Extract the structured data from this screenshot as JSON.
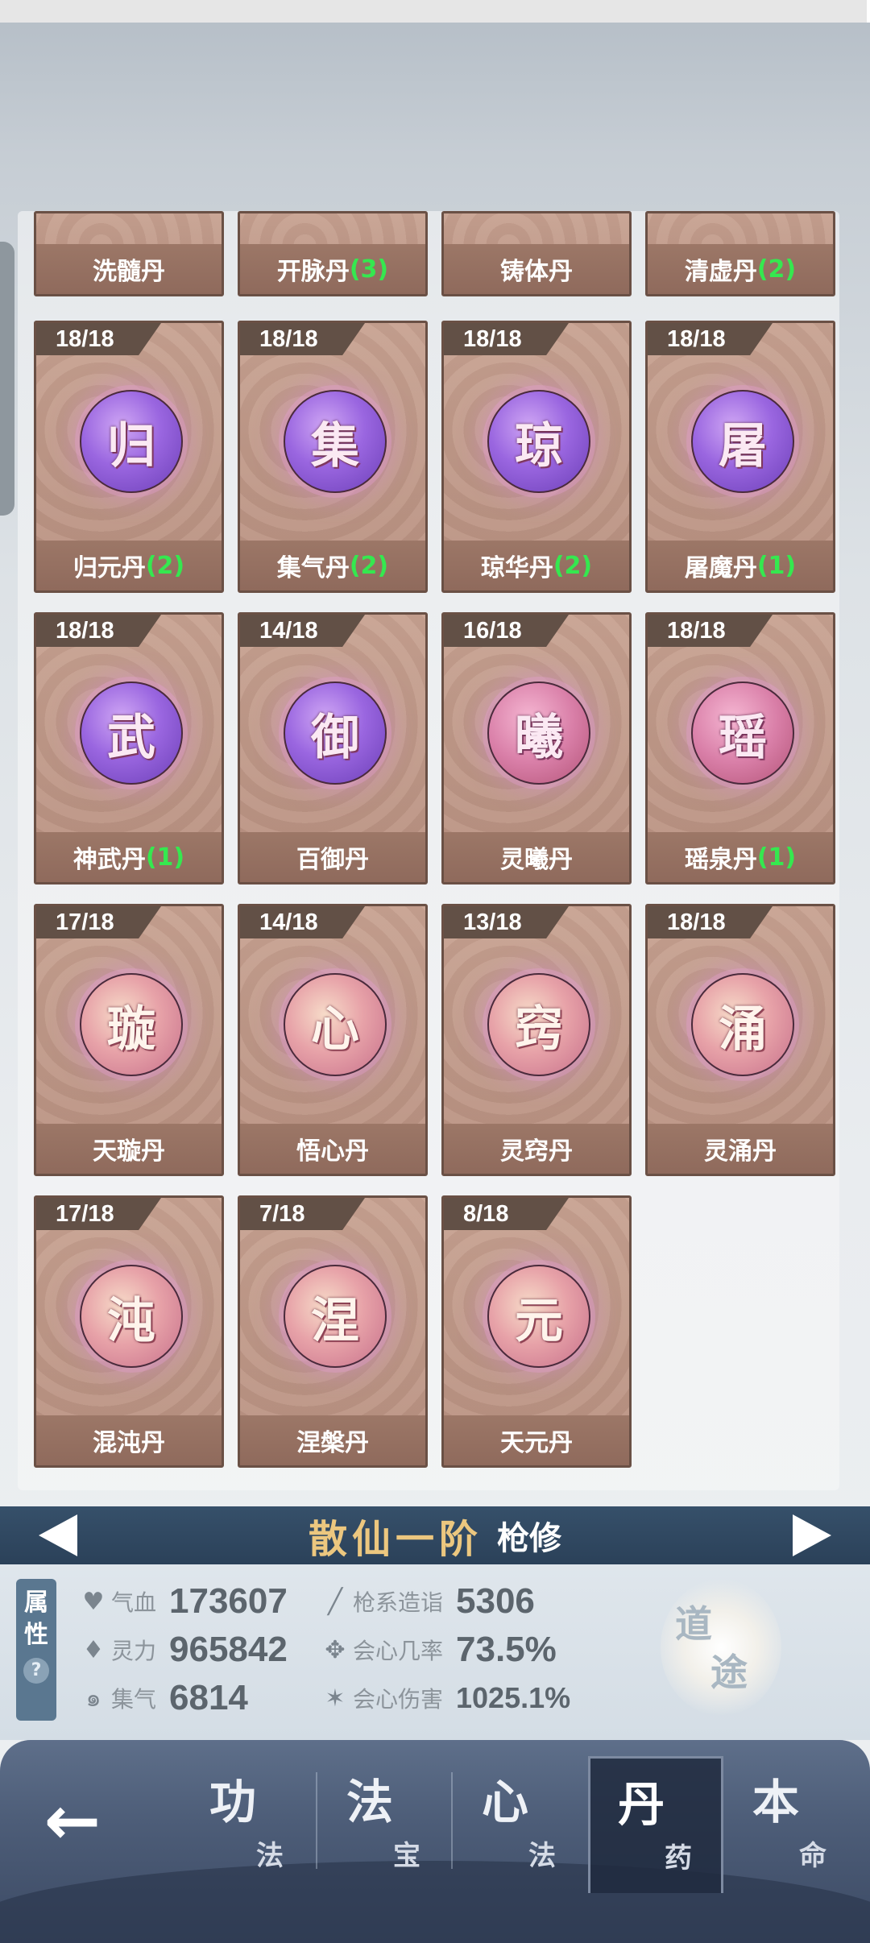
{
  "pills_row_cut": [
    {
      "name": "洗髓丹",
      "extra": ""
    },
    {
      "name": "开脉丹",
      "extra": "(3)"
    },
    {
      "name": "铸体丹",
      "extra": ""
    },
    {
      "name": "清虚丹",
      "extra": "(2)"
    }
  ],
  "pills": [
    {
      "count": "18/18",
      "glyph": "归",
      "name": "归元丹",
      "extra": "(2)",
      "style": "purple"
    },
    {
      "count": "18/18",
      "glyph": "集",
      "name": "集气丹",
      "extra": "(2)",
      "style": "purple"
    },
    {
      "count": "18/18",
      "glyph": "琼",
      "name": "琼华丹",
      "extra": "(2)",
      "style": "purple"
    },
    {
      "count": "18/18",
      "glyph": "屠",
      "name": "屠魔丹",
      "extra": "(1)",
      "style": "purple"
    },
    {
      "count": "18/18",
      "glyph": "武",
      "name": "神武丹",
      "extra": "(1)",
      "style": "purple"
    },
    {
      "count": "14/18",
      "glyph": "御",
      "name": "百御丹",
      "extra": "",
      "style": "purple"
    },
    {
      "count": "16/18",
      "glyph": "曦",
      "name": "灵曦丹",
      "extra": "",
      "style": "pink"
    },
    {
      "count": "18/18",
      "glyph": "瑶",
      "name": "瑶泉丹",
      "extra": "(1)",
      "style": "pink"
    },
    {
      "count": "17/18",
      "glyph": "璇",
      "name": "天璇丹",
      "extra": "",
      "style": "peach"
    },
    {
      "count": "14/18",
      "glyph": "心",
      "name": "悟心丹",
      "extra": "",
      "style": "peach"
    },
    {
      "count": "13/18",
      "glyph": "窍",
      "name": "灵窍丹",
      "extra": "",
      "style": "peach"
    },
    {
      "count": "18/18",
      "glyph": "涌",
      "name": "灵涌丹",
      "extra": "",
      "style": "peach"
    },
    {
      "count": "17/18",
      "glyph": "沌",
      "name": "混沌丹",
      "extra": "",
      "style": "peach"
    },
    {
      "count": "7/18",
      "glyph": "涅",
      "name": "涅槃丹",
      "extra": "",
      "style": "peach"
    },
    {
      "count": "8/18",
      "glyph": "元",
      "name": "天元丹",
      "extra": "",
      "style": "peach"
    }
  ],
  "realm": {
    "title": "散仙一阶",
    "sub": "枪修"
  },
  "attr_tab": {
    "line1": "属",
    "line2": "性",
    "help": "?"
  },
  "stats": {
    "qixue": {
      "icon": "heart-icon",
      "label": "气血",
      "value": "173607"
    },
    "lingli": {
      "icon": "flame-icon",
      "label": "灵力",
      "value": "965842"
    },
    "jiqi": {
      "icon": "swirl-icon",
      "label": "集气",
      "value": "6814"
    },
    "qiangxi": {
      "icon": "spear-icon",
      "label": "枪系造诣",
      "value": "5306"
    },
    "huixin_rate": {
      "icon": "crit-rate-icon",
      "label": "会心几率",
      "value": "73.5%"
    },
    "huixin_dmg": {
      "icon": "crit-damage-icon",
      "label": "会心伤害",
      "value": "1025.1%"
    }
  },
  "dao": {
    "c1": "道",
    "c2": "途"
  },
  "nav": {
    "back": "←",
    "tabs": [
      {
        "big": "功",
        "small": "法"
      },
      {
        "big": "法",
        "small": "宝"
      },
      {
        "big": "心",
        "small": "法"
      },
      {
        "big": "丹",
        "small": "药"
      },
      {
        "big": "本",
        "small": "命"
      }
    ],
    "active_index": 3
  },
  "colors": {
    "extra_green": "#35e84f",
    "realm_gold": "#ecc77f",
    "card_border": "#6a5045"
  }
}
